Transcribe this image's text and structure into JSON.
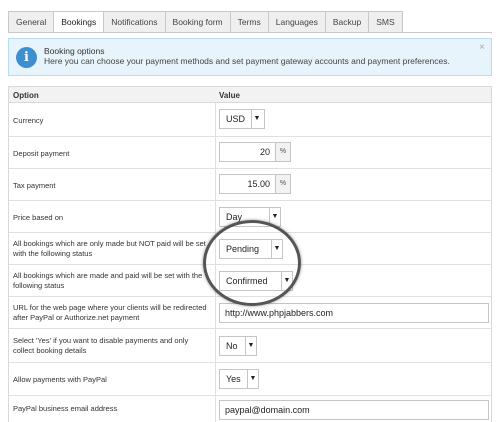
{
  "tabs": [
    "General",
    "Bookings",
    "Notifications",
    "Booking form",
    "Terms",
    "Languages",
    "Backup",
    "SMS"
  ],
  "active_tab": "Bookings",
  "notice": {
    "title": "Booking options",
    "description": "Here you can choose your payment methods and set payment gateway accounts and payment preferences.",
    "close": "×",
    "icon": "info-icon"
  },
  "table": {
    "header_option": "Option",
    "header_value": "Value"
  },
  "rows": {
    "currency": {
      "label": "Currency",
      "value": "USD"
    },
    "deposit": {
      "label": "Deposit payment",
      "value": "20",
      "unit": "%"
    },
    "tax": {
      "label": "Tax payment",
      "value": "15.00",
      "unit": "%"
    },
    "price_based": {
      "label": "Price based on",
      "value": "Day"
    },
    "not_paid_status": {
      "label": "All bookings which are only made but NOT paid will be set with the following status",
      "value": "Pending"
    },
    "paid_status": {
      "label": "All bookings which are made and paid will be set with the following status",
      "value": "Confirmed"
    },
    "url": {
      "label": "URL for the web page where your clients will be redirected after PayPal or Authorize.net payment",
      "value": "http://www.phpjabbers.com"
    },
    "disable_payments": {
      "label": "Select 'Yes' if you want to disable payments and only collect booking details",
      "value": "No"
    },
    "allow_paypal": {
      "label": "Allow payments with PayPal",
      "value": "Yes"
    },
    "paypal_email": {
      "label": "PayPal business email address",
      "value": "paypal@domain.com"
    }
  },
  "dropdown_arrow": "▼"
}
